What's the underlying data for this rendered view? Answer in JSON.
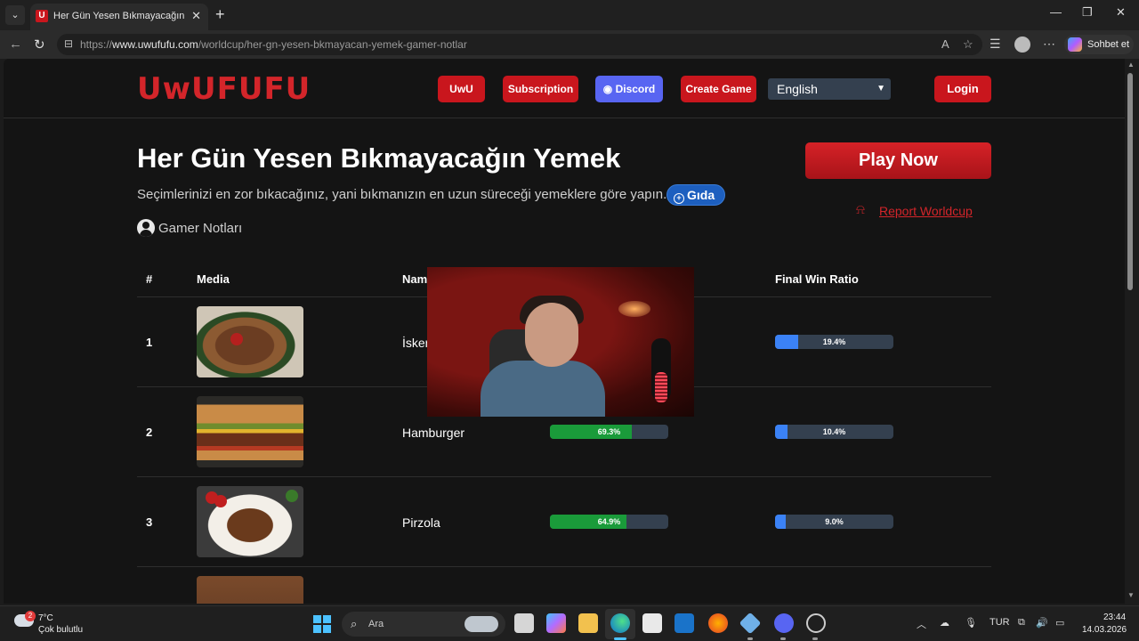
{
  "browser": {
    "tab_title": "Her Gün Yesen Bıkmayacağın Yemek",
    "url_prefix": "https://",
    "url_host": "www.uwufufu.com",
    "url_path": "/worldcup/her-gn-yesen-bkmayacan-yemek-gamer-notlar",
    "copilot_label": "Sohbet et"
  },
  "header": {
    "logo": "UwUFUFU",
    "uwu_label": "UwU",
    "subscription_label": "Subscription",
    "discord_label": "Discord",
    "create_game_label": "Create Game",
    "language": "English",
    "login_label": "Login"
  },
  "worldcup": {
    "title": "Her Gün Yesen Bıkmayacağın Yemek",
    "description": "Seçimlerinizi en zor bıkacağınız, yani bıkmanızın en uzun süreceği yemeklere göre yapın.",
    "tag": "Gıda",
    "author": "Gamer Notları",
    "play_label": "Play Now",
    "report_label": "Report Worldcup"
  },
  "table": {
    "headers": {
      "rank": "#",
      "media": "Media",
      "name": "Nam",
      "final_win_ratio": "Final Win Ratio"
    },
    "rows": [
      {
        "rank": "1",
        "name": "İsker",
        "win_rate": null,
        "win_rate_label": "",
        "final_win_ratio": 19.4,
        "final_win_ratio_label": "19.4%",
        "image": "iskender-kebab"
      },
      {
        "rank": "2",
        "name": "Hamburger",
        "win_rate": 69.3,
        "win_rate_label": "69.3%",
        "final_win_ratio": 10.4,
        "final_win_ratio_label": "10.4%",
        "image": "hamburger"
      },
      {
        "rank": "3",
        "name": "Pirzola",
        "win_rate": 64.9,
        "win_rate_label": "64.9%",
        "final_win_ratio": 9.0,
        "final_win_ratio_label": "9.0%",
        "image": "lamb-chops"
      }
    ]
  },
  "colors": {
    "brand_red": "#c9161d",
    "discord": "#5865f2",
    "win_green": "#1a9b3a",
    "ratio_blue": "#3b82f6"
  },
  "taskbar": {
    "weather_badge": "2",
    "weather_temp": "7°C",
    "weather_desc": "Çok bulutlu",
    "search_label": "Ara",
    "language": "TUR",
    "time": "23:44",
    "date": "14.03.2026"
  }
}
